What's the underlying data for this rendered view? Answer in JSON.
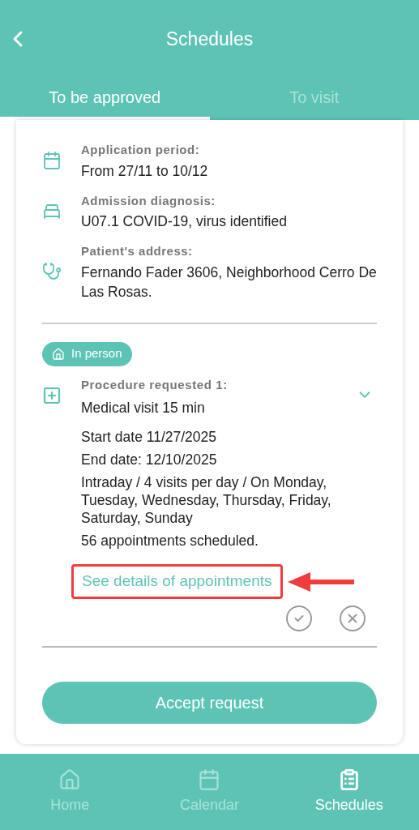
{
  "header": {
    "title": "Schedules"
  },
  "tabs": [
    {
      "label": "To be approved",
      "selected": true
    },
    {
      "label": "To visit",
      "selected": false
    }
  ],
  "details": [
    {
      "kind": "calendar",
      "label": "Application period:",
      "value": "From 27/11 to 10/12"
    },
    {
      "kind": "bed",
      "label": "Admission diagnosis:",
      "value": "U07.1 COVID-19, virus identified"
    },
    {
      "kind": "stethoscope",
      "label": "Patient's address:",
      "value": "Fernando Fader 3606, Neighborhood Cerro De Las Rosas."
    }
  ],
  "procedure": {
    "badge": "In person",
    "label": "Procedure requested 1:",
    "name": "Medical visit 15 min",
    "expanded": true,
    "lines": [
      "Start date 11/27/2025",
      "End date: 12/10/2025",
      "Intraday / 4 visits per day /  On Monday, Tuesday, Wednesday, Thursday, Friday, Saturday, Sunday",
      "56 appointments scheduled."
    ],
    "link": "See details of appointments",
    "link_highlighted": true
  },
  "accept_button": "Accept request",
  "nav": [
    {
      "kind": "home",
      "label": "Home",
      "selected": false
    },
    {
      "kind": "calendar",
      "label": "Calendar",
      "selected": false
    },
    {
      "kind": "schedules",
      "label": "Schedules",
      "selected": true
    }
  ]
}
